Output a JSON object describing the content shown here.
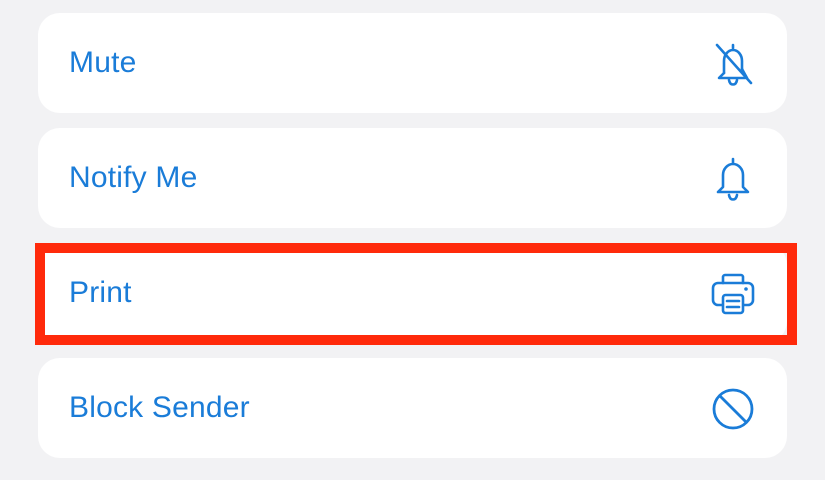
{
  "menu": {
    "items": [
      {
        "label": "Mute",
        "icon": "bell-slash-icon"
      },
      {
        "label": "Notify Me",
        "icon": "bell-icon"
      },
      {
        "label": "Print",
        "icon": "printer-icon"
      },
      {
        "label": "Block Sender",
        "icon": "block-icon"
      }
    ]
  },
  "colors": {
    "accent": "#1a7cd8",
    "highlight": "#ff2a0b",
    "background": "#f2f2f4",
    "card": "#ffffff"
  }
}
